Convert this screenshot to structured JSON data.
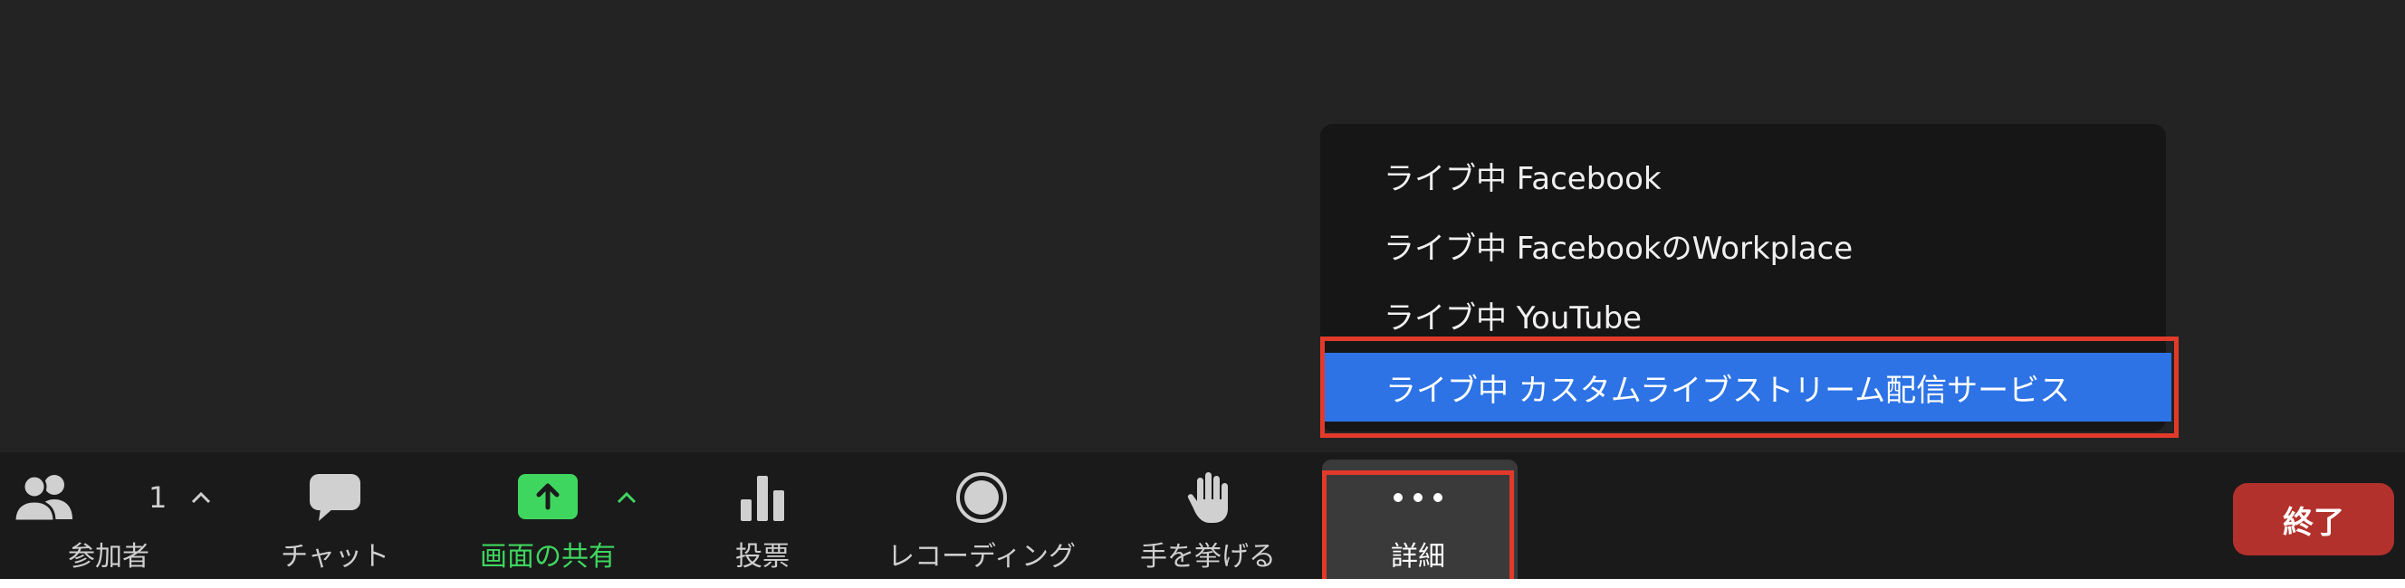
{
  "live_menu": {
    "items": [
      {
        "label": "ライブ中 Facebook"
      },
      {
        "label": "ライブ中 FacebookのWorkplace"
      },
      {
        "label": "ライブ中 YouTube"
      },
      {
        "label": "ライブ中 カスタムライブストリーム配信サービス",
        "selected": true
      }
    ]
  },
  "toolbar": {
    "participants": {
      "label": "参加者",
      "count": "1",
      "icon": "participants-icon"
    },
    "chat": {
      "label": "チャット",
      "icon": "chat-bubble-icon"
    },
    "share_screen": {
      "label": "画面の共有",
      "icon": "share-screen-icon",
      "color": "#3fd65f"
    },
    "polling": {
      "label": "投票",
      "icon": "bar-chart-icon"
    },
    "recording": {
      "label": "レコーディング",
      "icon": "record-icon"
    },
    "raise_hand": {
      "label": "手を挙げる",
      "icon": "hand-icon"
    },
    "more": {
      "label": "詳細",
      "icon": "more-dots-icon"
    },
    "end": {
      "label": "終了",
      "color": "#b3312c"
    }
  },
  "colors": {
    "background": "#232323",
    "toolbar": "#1a1a1a",
    "selection": "#2d73e6",
    "highlight_box": "#e23a2a"
  }
}
